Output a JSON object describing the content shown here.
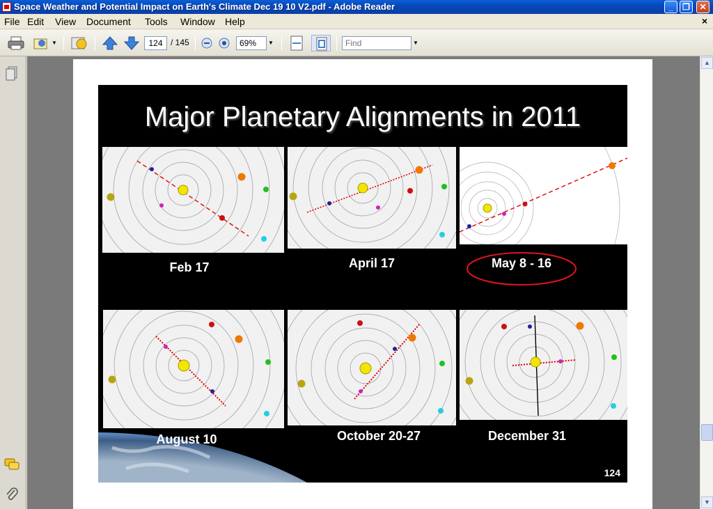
{
  "window": {
    "title": "Space Weather and Potential Impact on Earth's Climate Dec 19 10 V2.pdf - Adobe Reader"
  },
  "menu": {
    "items": [
      "File",
      "Edit",
      "View",
      "Document",
      "Tools",
      "Window",
      "Help"
    ],
    "close_doc": "×"
  },
  "toolbar": {
    "page_current": "124",
    "page_total": "/ 145",
    "zoom": "69%",
    "find_placeholder": "Find"
  },
  "slide": {
    "title": "Major Planetary Alignments in 2011",
    "panels": [
      {
        "caption": "Feb 17",
        "highlighted": false
      },
      {
        "caption": "April 17",
        "highlighted": false
      },
      {
        "caption": "May 8 - 16",
        "highlighted": true
      },
      {
        "caption": "August 10",
        "highlighted": false
      },
      {
        "caption": "October 20-27",
        "highlighted": false
      },
      {
        "caption": "December 31",
        "highlighted": false
      }
    ],
    "page_number": "124"
  },
  "colors": {
    "highlight_ring": "#e0141e",
    "alignment_line": "#e00000",
    "sun": "#f2e600"
  }
}
